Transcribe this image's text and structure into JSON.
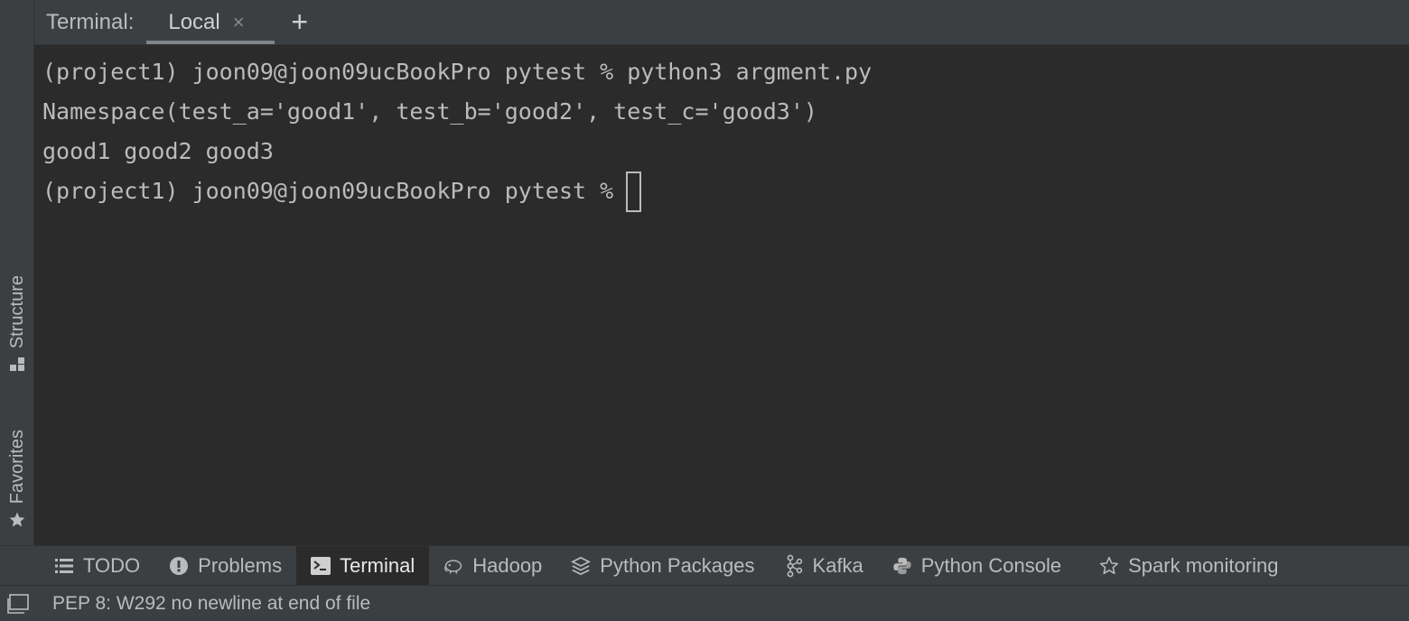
{
  "left_strip": {
    "structure_label": "Structure",
    "favorites_label": "Favorites"
  },
  "terminal": {
    "header_label": "Terminal:",
    "tab_label": "Local",
    "close_glyph": "×",
    "add_glyph": "+",
    "lines": [
      "(project1) joon09@joon09ucBookPro pytest % python3 argment.py",
      "Namespace(test_a='good1', test_b='good2', test_c='good3')",
      "good1 good2 good3",
      "(project1) joon09@joon09ucBookPro pytest %"
    ]
  },
  "tool_bar": {
    "items": [
      {
        "label": "TODO",
        "icon": "list-icon"
      },
      {
        "label": "Problems",
        "icon": "warning-circle-icon"
      },
      {
        "label": "Terminal",
        "icon": "terminal-icon",
        "active": true
      },
      {
        "label": "Hadoop",
        "icon": "hadoop-icon"
      },
      {
        "label": "Python Packages",
        "icon": "layers-icon"
      },
      {
        "label": "Kafka",
        "icon": "kafka-icon"
      },
      {
        "label": "Python Console",
        "icon": "python-icon"
      },
      {
        "label": "Spark monitoring",
        "icon": "star-icon"
      }
    ]
  },
  "status_bar": {
    "message": "PEP 8: W292 no newline at end of file"
  },
  "colors": {
    "background": "#2b2b2b",
    "panel": "#3c3f41",
    "text": "#bbbbbb"
  }
}
